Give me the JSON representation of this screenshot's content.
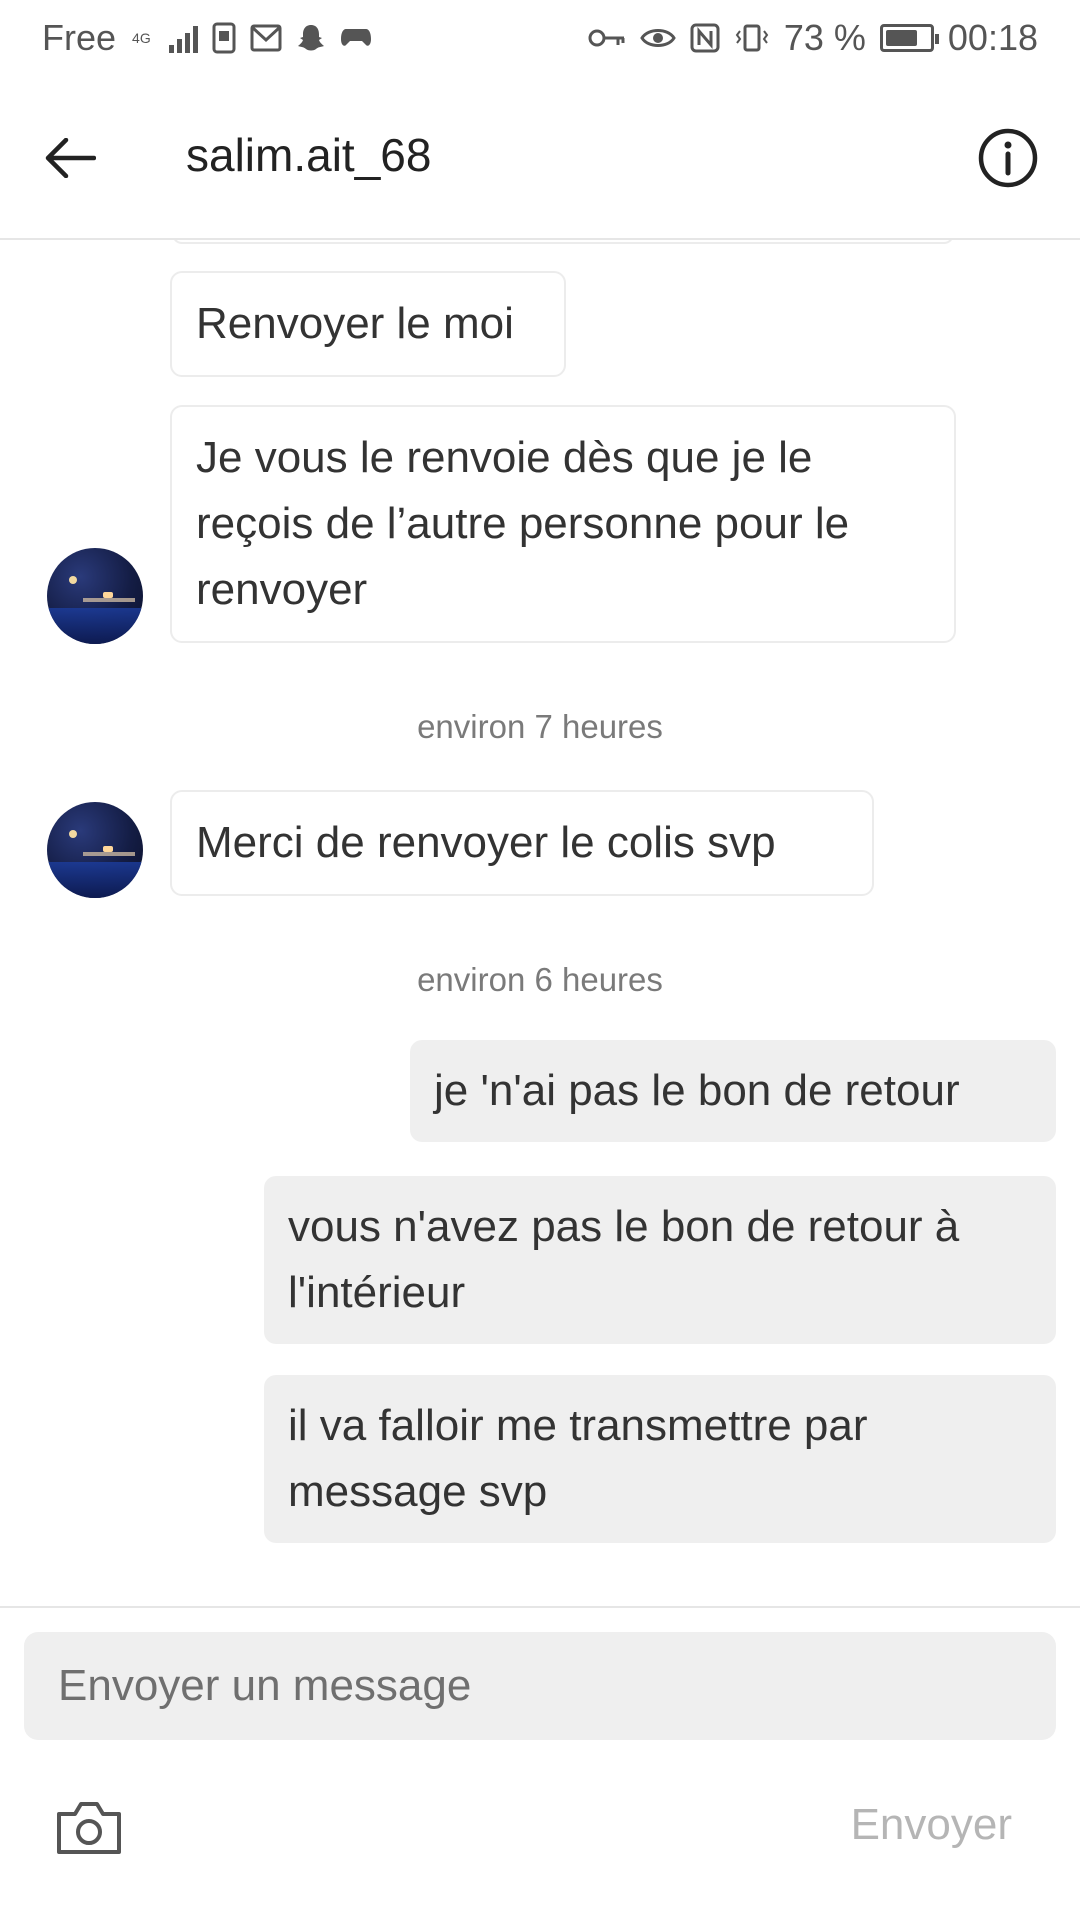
{
  "status_bar": {
    "carrier": "Free",
    "network": "4G",
    "battery": "73 %",
    "battery_level": 0.73,
    "time": "00:18"
  },
  "header": {
    "title": "salim.ait_68",
    "back_icon": "arrow-left-icon",
    "info_icon": "info-circle-icon"
  },
  "messages": [
    {
      "direction": "incoming",
      "text": "Renvoyer le moi"
    },
    {
      "direction": "incoming",
      "text": "Je vous le renvoie dès que je le reçois de l’autre personne pour le renvoyer"
    },
    {
      "type": "timestamp",
      "text": "environ 7 heures"
    },
    {
      "direction": "incoming",
      "text": "Merci de renvoyer le colis svp"
    },
    {
      "type": "timestamp",
      "text": "environ 6 heures"
    },
    {
      "direction": "outgoing",
      "text": "je 'n'ai pas le bon de retour"
    },
    {
      "direction": "outgoing",
      "text": "vous n'avez pas le bon de retour à l'intérieur"
    },
    {
      "direction": "outgoing",
      "text": "il va falloir me transmettre par message svp"
    }
  ],
  "composer": {
    "placeholder": "Envoyer un message",
    "send_label": "Envoyer",
    "camera_icon": "camera-icon"
  }
}
